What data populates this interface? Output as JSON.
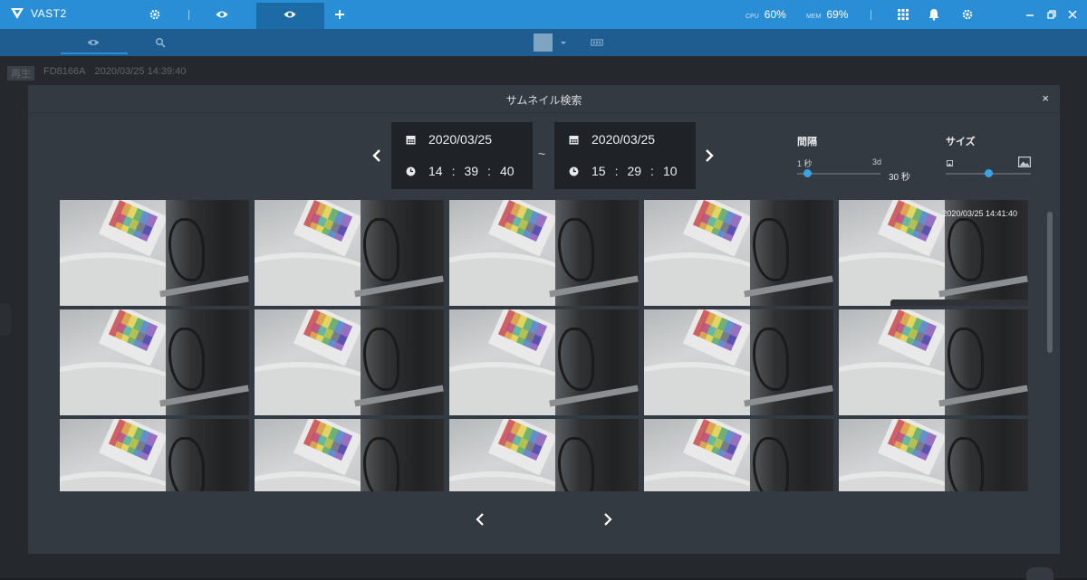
{
  "app": {
    "name": "VAST2"
  },
  "system": {
    "cpu_label": "CPU",
    "cpu_value": "60%",
    "mem_label": "MEM",
    "mem_value": "69%"
  },
  "camera": {
    "playback_label": "再生",
    "name": "FD8166A",
    "timestamp": "2020/03/25 14:39:40"
  },
  "dialog": {
    "title": "サムネイル検索",
    "close": "×",
    "start": {
      "date": "2020/03/25",
      "hour": "14",
      "minute": "39",
      "second": "40"
    },
    "end": {
      "date": "2020/03/25",
      "hour": "15",
      "minute": "29",
      "second": "10"
    },
    "separator": "~",
    "time_sep": ":",
    "interval": {
      "label": "間隔",
      "min": "1 秒",
      "max": "3d",
      "value": "30 秒",
      "position": 0.12
    },
    "size": {
      "label": "サイズ",
      "position": 0.5
    },
    "thumbnail_stamp": "2020/03/25 14:41:40",
    "thumbnails": {
      "rows": 3,
      "cols": 5
    }
  },
  "icons": {
    "settings": "gear-icon",
    "liveview": "eye-icon",
    "add": "plus-icon",
    "apps": "grid-icon",
    "notifications": "bell-icon"
  },
  "colors": {
    "topbar": "#2a8ed6",
    "subbar": "#1f5d90",
    "accent": "#3aa3e6",
    "dialog": "#343a41"
  }
}
